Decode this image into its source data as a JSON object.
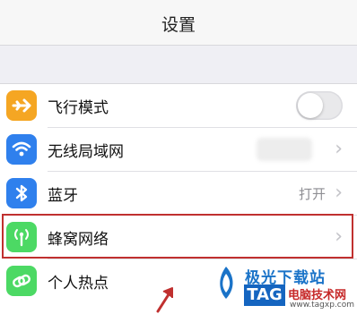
{
  "header": {
    "title": "设置"
  },
  "settings": {
    "items": [
      {
        "label": "飞行模式",
        "icon": "airplane-icon",
        "color": "#f5a623",
        "control": "toggle",
        "toggle_on": false
      },
      {
        "label": "无线局域网",
        "icon": "wifi-icon",
        "color": "#2f80ed",
        "control": "chevron",
        "value": ""
      },
      {
        "label": "蓝牙",
        "icon": "bluetooth-icon",
        "color": "#2f80ed",
        "control": "chevron",
        "value": "打开"
      },
      {
        "label": "蜂窝网络",
        "icon": "cellular-antenna-icon",
        "color": "#4cd964",
        "control": "chevron",
        "value": ""
      },
      {
        "label": "个人热点",
        "icon": "hotspot-link-icon",
        "color": "#4cd964",
        "control": "chevron",
        "value": ""
      }
    ],
    "chevron": "›"
  },
  "watermark": {
    "text_top": "极光下载站",
    "tag": "TAG",
    "text_main": "电脑技术网",
    "url": "www.tagxp.com"
  },
  "colors": {
    "highlight": "#c0302f",
    "ios_blue": "#2f80ed",
    "ios_green": "#4cd964",
    "ios_orange": "#f5a623"
  }
}
